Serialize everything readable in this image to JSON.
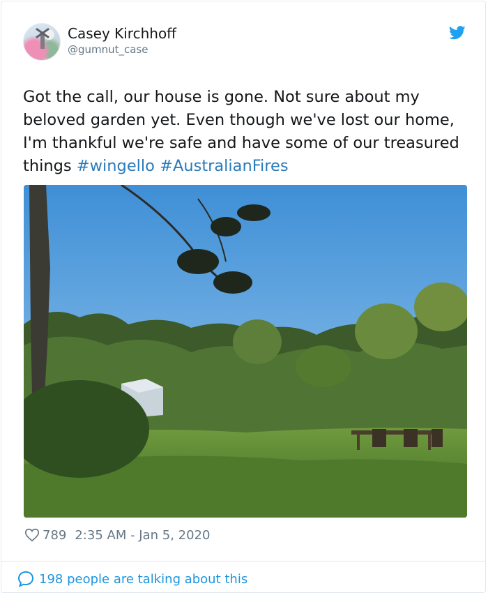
{
  "tweet": {
    "author_name": "Casey Kirchhoff",
    "author_handle": "@gumnut_case",
    "text_main": "Got the call, our house is gone. Not sure about my beloved garden yet. Even though we've lost our home, I'm thankful we're safe and have some of our treasured things ",
    "hashtags": [
      "#wingello",
      "#AustralianFires"
    ],
    "likes": "789",
    "timestamp": "2:35 AM - Jan 5, 2020",
    "conversation": "198 people are talking about this"
  },
  "colors": {
    "twitter_blue": "#1da1f2",
    "link_blue": "#2b7bb9",
    "secondary_text": "#657786",
    "border": "#e1e8ed"
  },
  "icons": {
    "brand": "twitter-bird-icon",
    "like": "heart-outline-icon",
    "conversation": "speech-bubble-icon"
  }
}
